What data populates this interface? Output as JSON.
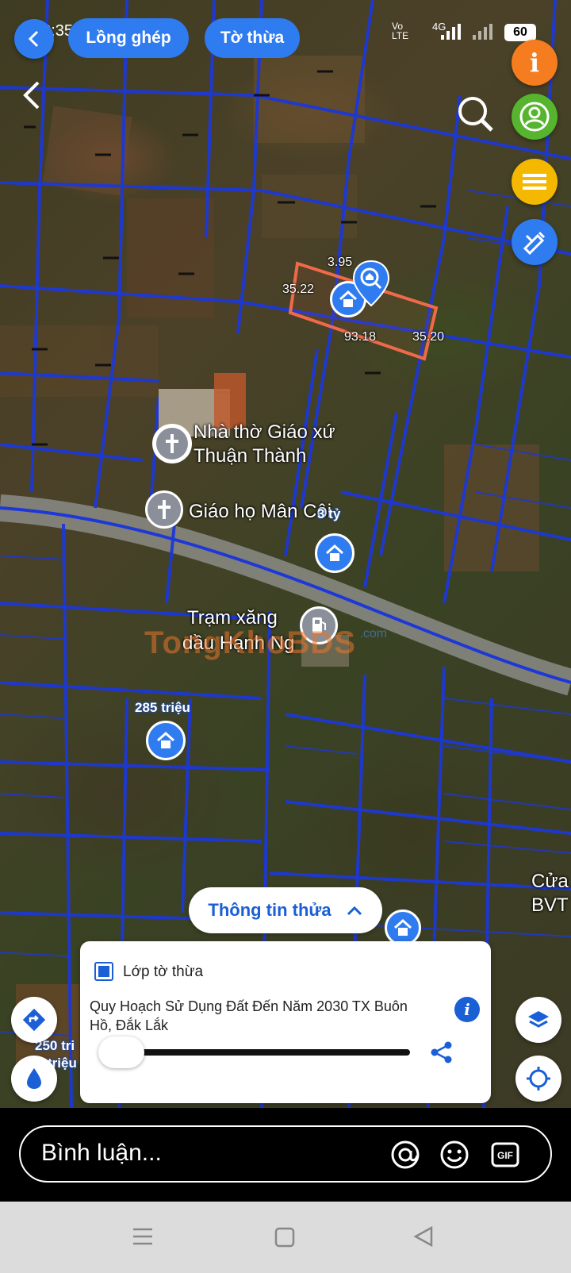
{
  "status_bar": {
    "time": "12:35",
    "network": "Vo LTE",
    "signal": "4G",
    "battery": "60"
  },
  "top_chips": {
    "merge_label": "Lồng ghép",
    "sheet_label": "Tờ thừa"
  },
  "parcel": {
    "top": "3.95",
    "left": "35.22",
    "bottom": "93.18",
    "right": "35.20"
  },
  "places": {
    "church_line1": "Nhà thờ Giáo xứ",
    "church_line2": "Thuận Thành",
    "parish": "Giáo họ Mân Côi",
    "gas_line1": "Trạm xăng",
    "gas_line2": "dầu Hạnh Ng",
    "bank_line1": "Cửa",
    "bank_line2": "BVT"
  },
  "listings": {
    "price1": "3 tỷ",
    "price2": "285 triệu",
    "price3": "250 tri",
    "price3b": "triệu"
  },
  "watermark": {
    "brand": "TongKhoBDS",
    "suffix": ".com"
  },
  "info_panel": {
    "toggle_label": "Thông tin thửa",
    "layer_title": "Lớp tờ thừa",
    "plan_line1": "Quy Hoạch Sử Dụng Đất Đến Năm 2030 TX Buôn",
    "plan_line2": "Hồ, Đắk Lắk",
    "opacity": 0.03
  },
  "comment": {
    "placeholder": "Bình luận..."
  },
  "colors": {
    "accent": "#2f7bf0",
    "parcel_lines": "#1d38d6",
    "highlight": "#f06a4a",
    "orange": "#f57c1f",
    "green": "#56b42e",
    "yellow": "#f5b800"
  }
}
